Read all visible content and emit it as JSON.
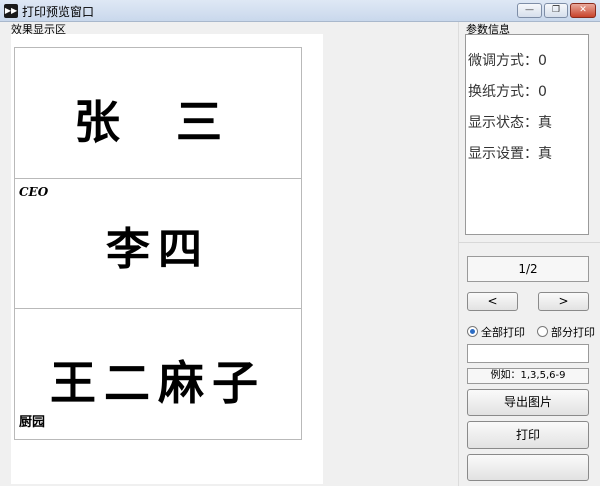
{
  "window": {
    "title": "打印预览窗口",
    "min_label": "—",
    "restore_label": "❐",
    "close_label": "✕"
  },
  "preview_section": {
    "label": "效果显示区",
    "cards": [
      {
        "name": "张 三",
        "tag": ""
      },
      {
        "name": "李四",
        "tag": "CEO"
      },
      {
        "name": "王二麻子",
        "tag": "厨园"
      }
    ]
  },
  "params_section": {
    "label": "参数信息",
    "rows": [
      {
        "label": "微调方式：",
        "value": "0"
      },
      {
        "label": "换纸方式：",
        "value": "0"
      },
      {
        "label": "显示状态：",
        "value": "真"
      },
      {
        "label": "显示设置：",
        "value": "真"
      }
    ]
  },
  "pager": {
    "display": "1/2",
    "prev_label": "<",
    "next_label": ">"
  },
  "print_mode": {
    "all_label": "全部打印",
    "partial_label": "部分打印",
    "selected": "all",
    "range_value": "",
    "example": "例如：1,3,5,6-9"
  },
  "actions": {
    "export_label": "导出图片",
    "print_label": "打印",
    "extra_label": ""
  }
}
